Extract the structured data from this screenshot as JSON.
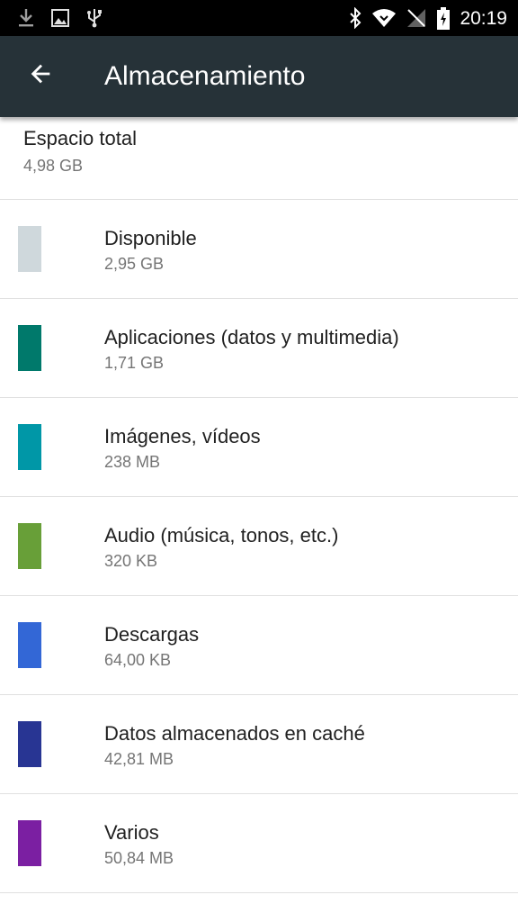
{
  "status_bar": {
    "time": "20:19",
    "left_icons": [
      "download-icon",
      "image-icon",
      "usb-icon"
    ],
    "right_icons": [
      "bluetooth-icon",
      "wifi-icon",
      "no-signal-icon",
      "battery-charging-icon"
    ]
  },
  "app_bar": {
    "back_icon": "arrow-left-icon",
    "title": "Almacenamiento",
    "background": "#263238"
  },
  "total": {
    "label": "Espacio total",
    "value": "4,98 GB"
  },
  "categories": [
    {
      "label": "Disponible",
      "value": "2,95 GB",
      "color": "#cfd8dc"
    },
    {
      "label": "Aplicaciones (datos y multimedia)",
      "value": "1,71 GB",
      "color": "#00796b"
    },
    {
      "label": "Imágenes, vídeos",
      "value": "238 MB",
      "color": "#0097a7"
    },
    {
      "label": "Audio (música, tonos, etc.)",
      "value": "320 KB",
      "color": "#689f38"
    },
    {
      "label": "Descargas",
      "value": "64,00 KB",
      "color": "#3367d6"
    },
    {
      "label": "Datos almacenados en caché",
      "value": "42,81 MB",
      "color": "#283593"
    },
    {
      "label": "Varios",
      "value": "50,84 MB",
      "color": "#7b1fa2"
    }
  ]
}
